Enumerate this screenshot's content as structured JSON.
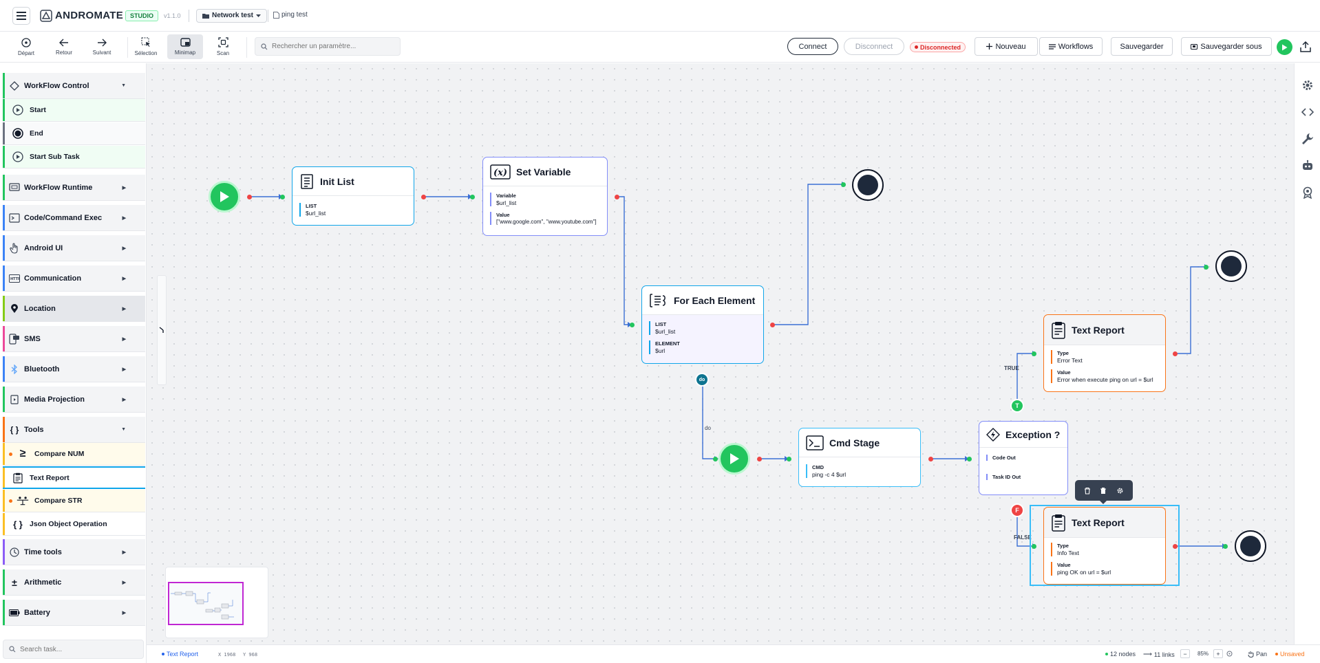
{
  "app": {
    "brand": "ANDROMATE",
    "studio_badge": "STUDIO",
    "version": "v1.1.0",
    "project": "Network test",
    "task": "ping test"
  },
  "toolbar": {
    "depart": "Départ",
    "retour": "Retour",
    "suivant": "Suivant",
    "selection": "Sélection",
    "minimap": "Minimap",
    "scan": "Scan",
    "search_placeholder": "Rechercher un paramètre...",
    "connect": "Connect",
    "disconnect": "Disconnect",
    "status": "Disconnected",
    "nouveau": "Nouveau",
    "workflows": "Workflows",
    "sauvegarder": "Sauvegarder",
    "sauvegarder_sous": "Sauvegarder sous"
  },
  "sidebar": {
    "categories": {
      "workflow_control": "WorkFlow Control",
      "workflow_runtime": "WorkFlow Runtime",
      "code_exec": "Code/Command Exec",
      "android_ui": "Android UI",
      "communication": "Communication",
      "location": "Location",
      "sms": "SMS",
      "bluetooth": "Bluetooth",
      "media_projection": "Media Projection",
      "tools": "Tools",
      "time_tools": "Time tools",
      "arithmetic": "Arithmetic",
      "battery": "Battery"
    },
    "control_items": [
      "Start",
      "End",
      "Start Sub Task"
    ],
    "tools_items": [
      "Compare NUM",
      "Text Report",
      "Compare STR",
      "Json Object Operation"
    ],
    "search_placeholder": "Search task..."
  },
  "nodes": {
    "init_list": {
      "title": "Init List",
      "field_key": "LIST",
      "field_value": "$url_list"
    },
    "set_variable": {
      "title": "Set Variable",
      "var_key": "Variable",
      "var_value": "$url_list",
      "val_key": "Value",
      "val_value": "[\"www.google.com\", \"www.youtube.com\"]"
    },
    "for_each": {
      "title": "For Each Element",
      "list_key": "LIST",
      "list_value": "$url_list",
      "elem_key": "ELEMENT",
      "elem_value": "$url",
      "do_badge": "do",
      "do_label": "do"
    },
    "text_report_error": {
      "title": "Text Report",
      "type_key": "Type",
      "type_value": "Error Text",
      "val_key": "Value",
      "val_value": "Error when execute ping on url = $url"
    },
    "cmd_stage": {
      "title": "Cmd Stage",
      "cmd_key": "CMD",
      "cmd_value": "ping -c 4 $url"
    },
    "exception": {
      "title": "Exception ?",
      "out1": "Code Out",
      "out2": "Task ID Out",
      "true_badge": "T",
      "false_badge": "F",
      "true_label": "TRUE",
      "false_label": "FALSE"
    },
    "text_report_info": {
      "title": "Text Report",
      "type_key": "Type",
      "type_value": "Info Text",
      "val_key": "Value",
      "val_value": "ping OK on url = $url"
    }
  },
  "statusbar": {
    "selected": "Text Report",
    "x": "X 1968",
    "y": "Y 968",
    "nodes": "12 nodes",
    "links": "11 links",
    "zoom": "85%",
    "pan": "Pan",
    "unsaved": "Unsaved"
  },
  "colors": {
    "accent_green": "#22c55e",
    "accent_red": "#ef4444",
    "edge_blue": "#3b6fd4",
    "selection_cyan": "#38bdf8"
  }
}
